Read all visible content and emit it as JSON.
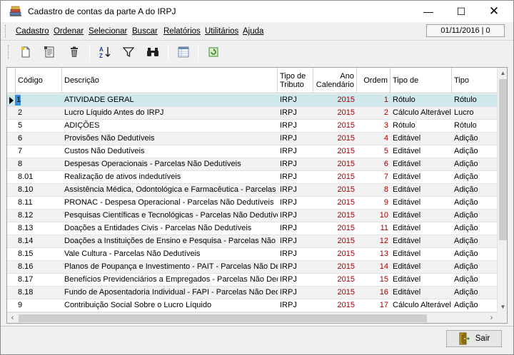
{
  "window": {
    "title": "Cadastro de contas da parte A do IRPJ",
    "minimize": "—",
    "maximize": "☐",
    "close": "✕"
  },
  "menu": {
    "items": [
      {
        "label": "Cadastro"
      },
      {
        "label": "Ordenar"
      },
      {
        "label": "Selecionar"
      },
      {
        "label": "Buscar"
      },
      {
        "label": "Relatórios"
      },
      {
        "label": "Utilitários"
      },
      {
        "label": "Ajuda"
      }
    ],
    "date": "01/11/2016 | 0"
  },
  "toolbar": {
    "buttons": [
      "new-document-icon",
      "edit-document-icon",
      "delete-trash-icon",
      "sort-az-icon",
      "filter-icon",
      "binoculars-search-icon",
      "columns-grid-icon",
      "refresh-icon"
    ]
  },
  "grid": {
    "columns": [
      {
        "label": "Código"
      },
      {
        "label": "Descrição"
      },
      {
        "label": "Tipo de Tributo"
      },
      {
        "label": "Ano Calendário"
      },
      {
        "label": "Ordem"
      },
      {
        "label": "Tipo de Registro"
      },
      {
        "label": "Tipo Lançar"
      }
    ],
    "rows": [
      {
        "codigo": "1",
        "descricao": "ATIVIDADE GERAL",
        "tributo": "IRPJ",
        "ano": "2015",
        "ordem": "1",
        "registro": "Rótulo",
        "lancamento": "Rótulo"
      },
      {
        "codigo": "2",
        "descricao": "Lucro Líquido Antes do IRPJ",
        "tributo": "IRPJ",
        "ano": "2015",
        "ordem": "2",
        "registro": "Cálculo Alterável",
        "lancamento": "Lucro"
      },
      {
        "codigo": "5",
        "descricao": "ADIÇÕES",
        "tributo": "IRPJ",
        "ano": "2015",
        "ordem": "3",
        "registro": "Rótulo",
        "lancamento": "Rótulo"
      },
      {
        "codigo": "6",
        "descricao": "Provisões Não Dedutíveis",
        "tributo": "IRPJ",
        "ano": "2015",
        "ordem": "4",
        "registro": "Editável",
        "lancamento": "Adição"
      },
      {
        "codigo": "7",
        "descricao": "Custos Não Dedutíveis",
        "tributo": "IRPJ",
        "ano": "2015",
        "ordem": "5",
        "registro": "Editável",
        "lancamento": "Adição"
      },
      {
        "codigo": "8",
        "descricao": "Despesas Operacionais - Parcelas Não Dedutíveis",
        "tributo": "IRPJ",
        "ano": "2015",
        "ordem": "6",
        "registro": "Editável",
        "lancamento": "Adição"
      },
      {
        "codigo": "8.01",
        "descricao": "Realização de ativos indedutíveis",
        "tributo": "IRPJ",
        "ano": "2015",
        "ordem": "7",
        "registro": "Editável",
        "lancamento": "Adição"
      },
      {
        "codigo": "8.10",
        "descricao": "Assistência Médica, Odontológica e Farmacêutica - Parcelas N",
        "tributo": "IRPJ",
        "ano": "2015",
        "ordem": "8",
        "registro": "Editável",
        "lancamento": "Adição"
      },
      {
        "codigo": "8.11",
        "descricao": "PRONAC - Despesa Operacional - Parcelas Não Dedutíveis",
        "tributo": "IRPJ",
        "ano": "2015",
        "ordem": "9",
        "registro": "Editável",
        "lancamento": "Adição"
      },
      {
        "codigo": "8.12",
        "descricao": "Pesquisas Científicas e Tecnológicas - Parcelas Não Dedutíve",
        "tributo": "IRPJ",
        "ano": "2015",
        "ordem": "10",
        "registro": "Editável",
        "lancamento": "Adição"
      },
      {
        "codigo": "8.13",
        "descricao": "Doações a Entidades Civis - Parcelas Não Dedutíveis",
        "tributo": "IRPJ",
        "ano": "2015",
        "ordem": "11",
        "registro": "Editável",
        "lancamento": "Adição"
      },
      {
        "codigo": "8.14",
        "descricao": "Doações a Instituições de Ensino e Pesquisa - Parcelas Não D",
        "tributo": "IRPJ",
        "ano": "2015",
        "ordem": "12",
        "registro": "Editável",
        "lancamento": "Adição"
      },
      {
        "codigo": "8.15",
        "descricao": "Vale Cultura - Parcelas Não Dedutíveis",
        "tributo": "IRPJ",
        "ano": "2015",
        "ordem": "13",
        "registro": "Editável",
        "lancamento": "Adição"
      },
      {
        "codigo": "8.16",
        "descricao": "Planos de Poupança e Investimento - PAIT - Parcelas Não Dec",
        "tributo": "IRPJ",
        "ano": "2015",
        "ordem": "14",
        "registro": "Editável",
        "lancamento": "Adição"
      },
      {
        "codigo": "8.17",
        "descricao": "Benefícios Previdenciários a Empregados - Parcelas Não Dedu",
        "tributo": "IRPJ",
        "ano": "2015",
        "ordem": "15",
        "registro": "Editável",
        "lancamento": "Adição"
      },
      {
        "codigo": "8.18",
        "descricao": "Fundo de Aposentadoria Individual - FAPI - Parcelas Não Dedu",
        "tributo": "IRPJ",
        "ano": "2015",
        "ordem": "16",
        "registro": "Editável",
        "lancamento": "Adição"
      },
      {
        "codigo": "9",
        "descricao": "Contribuição Social Sobre o Lucro Líquido",
        "tributo": "IRPJ",
        "ano": "2015",
        "ordem": "17",
        "registro": "Cálculo Alterável",
        "lancamento": "Adição"
      }
    ],
    "selected_row": 0
  },
  "footer": {
    "exit_label": "Sair"
  },
  "colors": {
    "selected_row": "#cfe8ec",
    "year_text": "#a80000"
  }
}
